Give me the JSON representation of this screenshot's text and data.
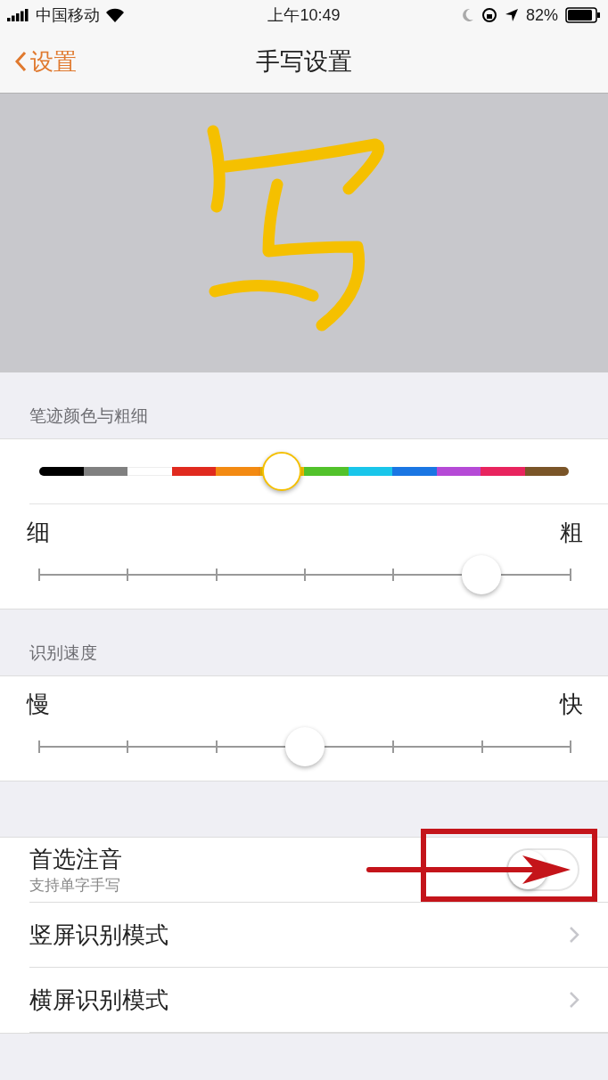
{
  "status_bar": {
    "carrier": "中国移动",
    "time": "上午10:49",
    "battery": "82%"
  },
  "nav": {
    "back": "设置",
    "title": "手写设置"
  },
  "pen_section": {
    "header": "笔迹颜色与粗细",
    "color_slider": {
      "swatches": [
        {
          "color": "#000000",
          "selected": false
        },
        {
          "color": "#808080",
          "selected": false
        },
        {
          "color": "#ffffff",
          "selected": false
        },
        {
          "color": "#e02a1f",
          "selected": false
        },
        {
          "color": "#f38a12",
          "selected": false
        },
        {
          "color": "#f5c000",
          "selected": true
        },
        {
          "color": "#52c22b",
          "selected": false
        },
        {
          "color": "#19c6ea",
          "selected": false
        },
        {
          "color": "#1a76e3",
          "selected": false
        },
        {
          "color": "#b54ad6",
          "selected": false
        },
        {
          "color": "#e8245e",
          "selected": false
        },
        {
          "color": "#7a5528",
          "selected": false
        }
      ]
    },
    "thickness": {
      "min_label": "细",
      "max_label": "粗",
      "level": 0.833
    }
  },
  "speed_section": {
    "header": "识别速度",
    "min_label": "慢",
    "max_label": "快",
    "level": 0.5
  },
  "options": [
    {
      "kind": "toggle",
      "label": "首选注音",
      "sublabel": "支持单字手写",
      "on": false,
      "annotated": true
    },
    {
      "kind": "link",
      "label": "竖屏识别模式"
    },
    {
      "kind": "link",
      "label": "横屏识别模式"
    }
  ]
}
